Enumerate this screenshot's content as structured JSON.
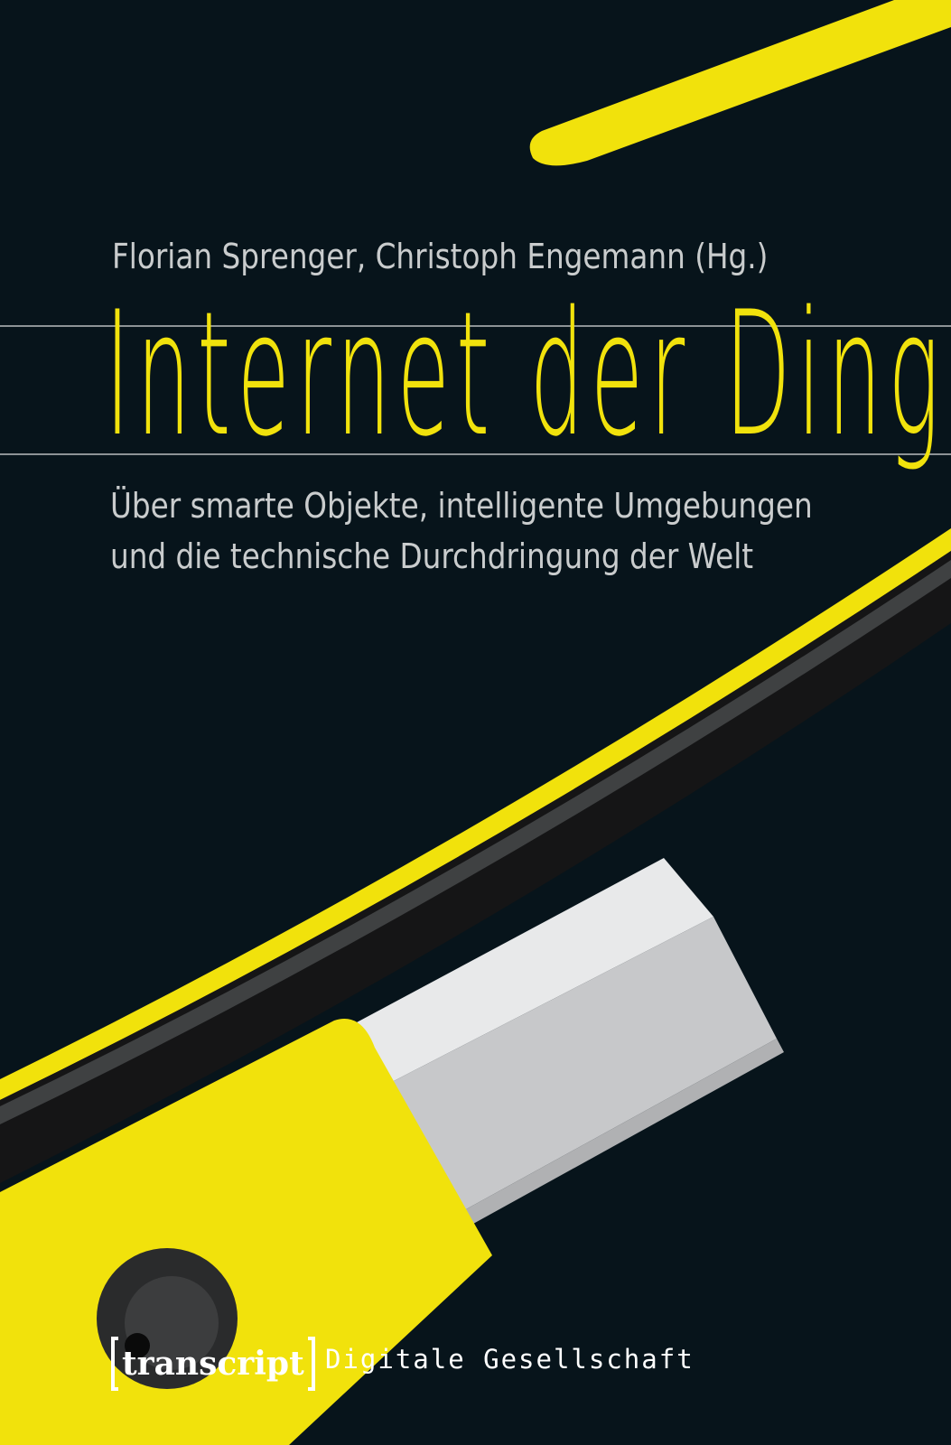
{
  "cover": {
    "authors": "Florian Sprenger, Christoph Engemann (Hg.)",
    "title": "Internet der Dinge",
    "subtitle_line1": "Über smarte Objekte, intelligente Umgebungen",
    "subtitle_line2": "und die technische Durchdringung der Welt",
    "publisher": "transcript",
    "series": "Digitale Gesellschaft"
  },
  "colors": {
    "background": "#07141b",
    "accent_yellow": "#f1e20c",
    "text_gray": "#c9cccd",
    "rule_gray": "#8d9396"
  },
  "illustration": {
    "description_icon": "glasses-frame-illustration"
  }
}
